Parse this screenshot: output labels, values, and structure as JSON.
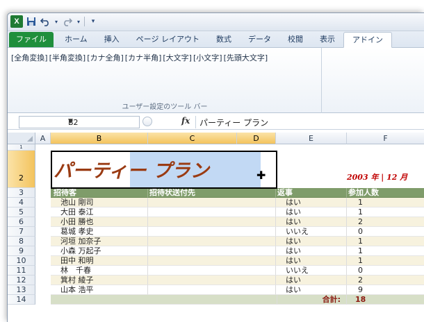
{
  "qat": {
    "app_icon": "X",
    "save_icon": "save-icon",
    "undo_icon": "undo-icon",
    "redo_icon": "redo-icon",
    "customize_icon": "customize-icon"
  },
  "tabs": [
    "ファイル",
    "ホーム",
    "挿入",
    "ページ レイアウト",
    "数式",
    "データ",
    "校閲",
    "表示",
    "アドイン"
  ],
  "ribbon": {
    "buttons": [
      "[全角変換]",
      "[半角変換]",
      "[カナ全角]",
      "[カナ半角]",
      "[大文字]",
      "[小文字]",
      "[先頭大文字]"
    ],
    "group_label": "ユーザー設定のツール バー"
  },
  "formula_bar": {
    "name_box": "B2",
    "fx": "fx",
    "content": "パーティー プラン"
  },
  "columns": [
    "A",
    "B",
    "C",
    "D",
    "E",
    "F"
  ],
  "rows": [
    "1",
    "2",
    "3",
    "4",
    "5",
    "6",
    "7",
    "8",
    "9",
    "10",
    "11",
    "12",
    "13",
    "14"
  ],
  "sheet": {
    "title": "パーティー プラン",
    "date": "2003 年 | 12 月",
    "headers": [
      "招待客",
      "招待状送付先",
      "返事",
      "参加人数"
    ],
    "guests": [
      {
        "name": "池山 剛司",
        "reply": "はい",
        "count": "1"
      },
      {
        "name": "大田 泰江",
        "reply": "はい",
        "count": "1"
      },
      {
        "name": "小田 勝也",
        "reply": "はい",
        "count": "2"
      },
      {
        "name": "葛城 孝史",
        "reply": "いいえ",
        "count": "0"
      },
      {
        "name": "河垣 加奈子",
        "reply": "はい",
        "count": "1"
      },
      {
        "name": "小森 万起子",
        "reply": "はい",
        "count": "1"
      },
      {
        "name": "田中 和明",
        "reply": "はい",
        "count": "1"
      },
      {
        "name": "林　千春",
        "reply": "いいえ",
        "count": "0"
      },
      {
        "name": "箕村 綾子",
        "reply": "はい",
        "count": "2"
      },
      {
        "name": "山本 浩平",
        "reply": "はい",
        "count": "9"
      }
    ],
    "total_label": "合計:",
    "total_value": "18"
  }
}
